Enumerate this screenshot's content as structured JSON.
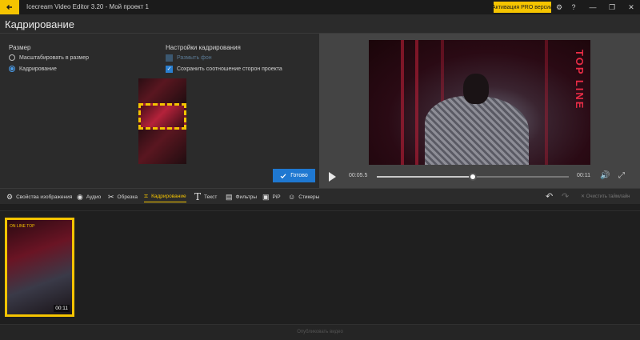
{
  "window": {
    "title": "Icecream Video Editor 3.20  -  Мой проект 1",
    "pro_button": "Активация PRO версии",
    "accent": "#f5c400"
  },
  "header": {
    "title": "Кадрирование"
  },
  "size_section": {
    "label": "Размер",
    "options": [
      {
        "label": "Масштабировать в размер",
        "selected": false
      },
      {
        "label": "Кадрирование",
        "selected": true
      }
    ]
  },
  "crop_settings": {
    "label": "Настройки кадрирования",
    "blur_background": {
      "label": "Размыть фон",
      "checked": false
    },
    "keep_aspect": {
      "label": "Сохранить соотношение сторон проекта",
      "checked": true
    }
  },
  "done_button": "Готово",
  "video_overlay_text": "TOP LINE",
  "player": {
    "current_time": "00:05.5",
    "total_time": "00:11",
    "progress": 0.5
  },
  "tools": [
    {
      "id": "image-props",
      "label": "Свойства изображения",
      "icon": "image-icon",
      "active": false
    },
    {
      "id": "audio",
      "label": "Аудио",
      "icon": "audio-icon",
      "active": false
    },
    {
      "id": "trim",
      "label": "Обрезка",
      "icon": "scissors-icon",
      "active": false
    },
    {
      "id": "crop",
      "label": "Кадрирование",
      "icon": "crop-icon",
      "active": true
    },
    {
      "id": "text",
      "label": "Текст",
      "icon": "text-icon",
      "active": false
    },
    {
      "id": "filters",
      "label": "Фильтры",
      "icon": "filter-icon",
      "active": false
    },
    {
      "id": "pip",
      "label": "PiP",
      "icon": "pip-icon",
      "active": false
    },
    {
      "id": "stickers",
      "label": "Стикеры",
      "icon": "sticker-icon",
      "active": false
    }
  ],
  "clear_timeline": "Очистить таймлайн",
  "clip": {
    "duration": "00:11",
    "overlay_text": "ON LINE TOP"
  },
  "footer": {
    "text": "Опубликовать видео"
  }
}
